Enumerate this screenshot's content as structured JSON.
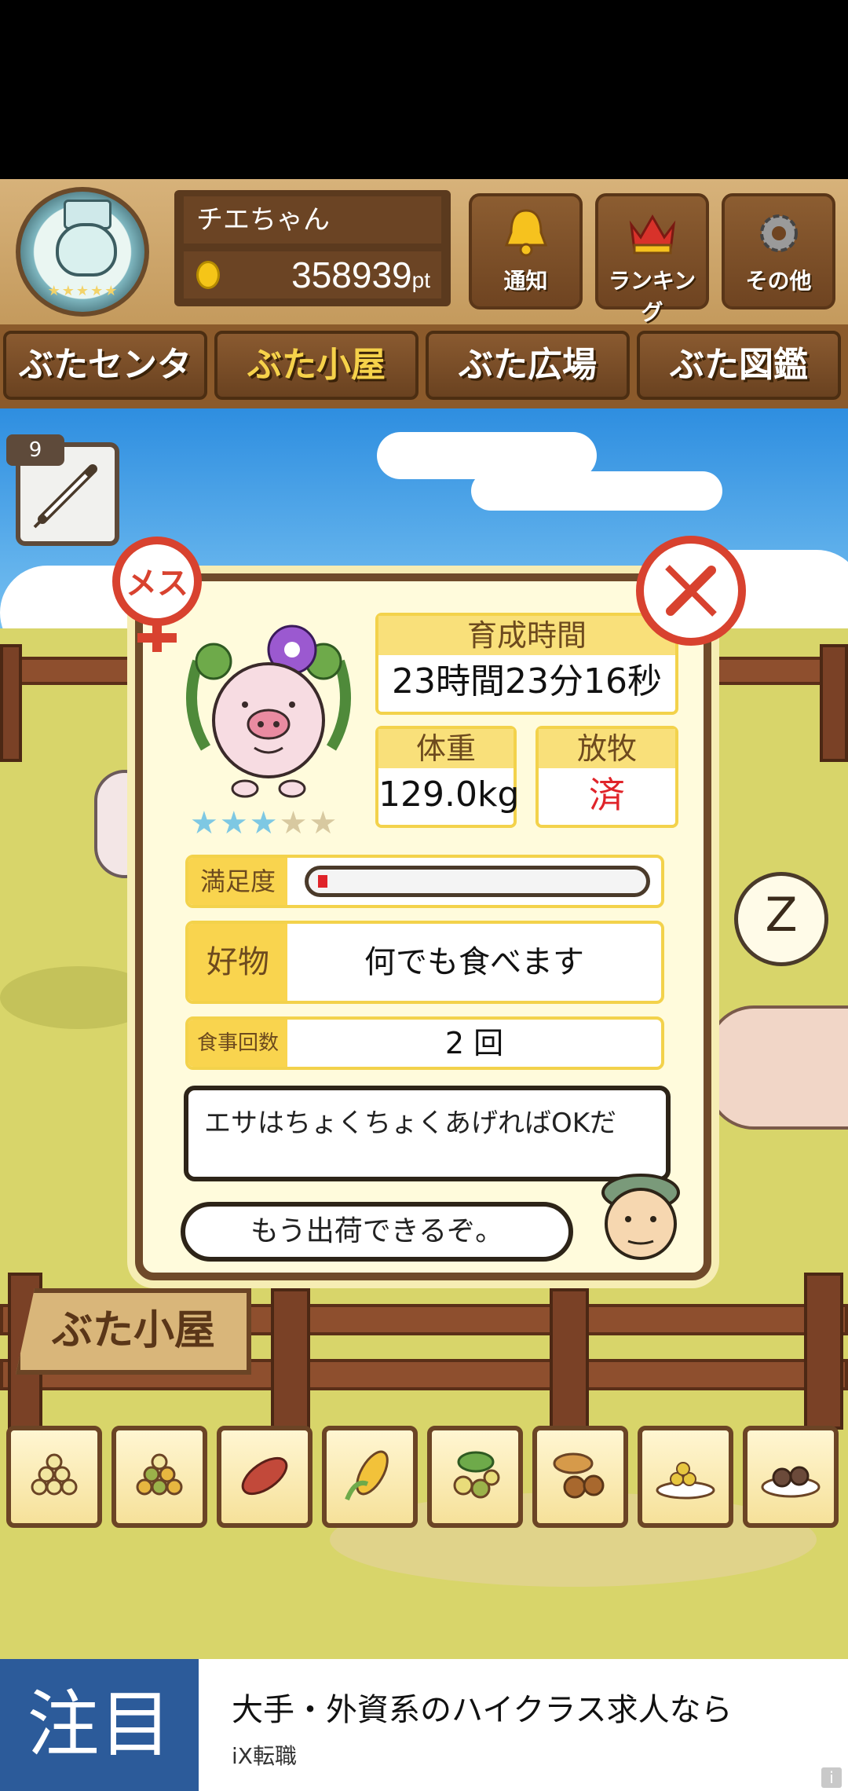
{
  "header": {
    "player_name": "チエちゃん",
    "points_value": "358939",
    "points_unit": "pt",
    "buttons": [
      {
        "label": "通知",
        "icon": "bell-icon"
      },
      {
        "label": "ランキング",
        "icon": "crown-icon"
      },
      {
        "label": "その他",
        "icon": "gear-icon"
      }
    ]
  },
  "nav": {
    "tabs": [
      {
        "label": "ぶたセンター",
        "active": false
      },
      {
        "label": "ぶた小屋",
        "active": true
      },
      {
        "label": "ぶた広場",
        "active": false
      },
      {
        "label": "ぶた図鑑",
        "active": false
      }
    ]
  },
  "syringe": {
    "count": "9"
  },
  "pig_card": {
    "gender_label": "メス",
    "rating_stars": 3,
    "rating_max": 5,
    "grow_time_label": "育成時間",
    "grow_time_value": "23時間23分16秒",
    "weight_label": "体重",
    "weight_value": "129.0kg",
    "release_label": "放牧",
    "release_value": "済",
    "satisfaction_label": "満足度",
    "satisfaction_level": 0.03,
    "favorite_label": "好物",
    "favorite_value": "何でも食べます",
    "meals_label": "食事回数",
    "meals_value": "2 回",
    "speech_1": "エサはちょくちょくあげればOKだ",
    "speech_2": "もう出荷できるぞ。"
  },
  "scene": {
    "sign_label": "ぶた小屋"
  },
  "foods": [
    {
      "icon": "grain-pile-icon"
    },
    {
      "icon": "mixed-grain-icon"
    },
    {
      "icon": "sweet-potato-icon"
    },
    {
      "icon": "corn-icon"
    },
    {
      "icon": "soybean-icon"
    },
    {
      "icon": "acorn-icon"
    },
    {
      "icon": "grain-plate-icon"
    },
    {
      "icon": "meatball-plate-icon"
    }
  ],
  "ad": {
    "badge": "注目",
    "title": "大手・外資系のハイクラス求人なら",
    "subtitle": "iX転職",
    "info_icon": "info-icon"
  },
  "colors": {
    "wood": "#8b5a2b",
    "accent_yellow": "#f6d24a",
    "female_red": "#d8422f",
    "star_blue": "#7ec8e3"
  }
}
